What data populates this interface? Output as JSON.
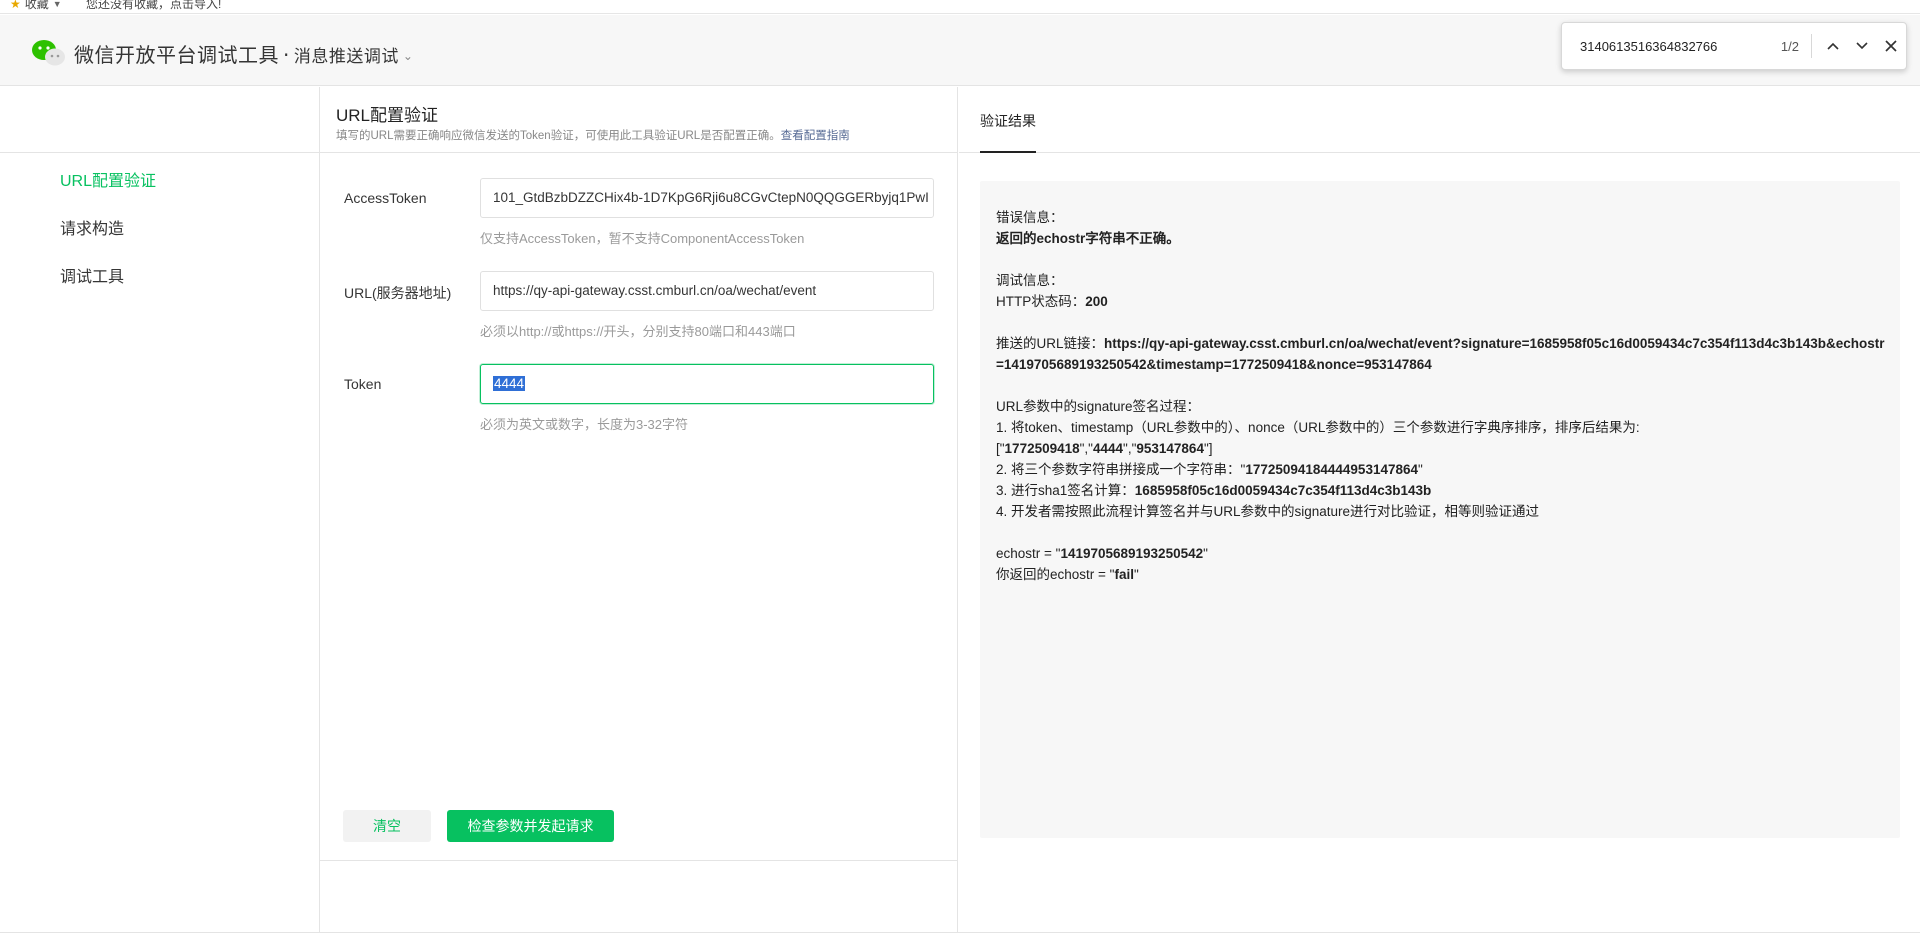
{
  "bookmarks": {
    "favorites_label": "收藏",
    "hint": "您还没有收藏，点击导入!"
  },
  "header": {
    "title": "微信开放平台调试工具",
    "separator": "·",
    "subtitle": "消息推送调试"
  },
  "find_bar": {
    "query": "3140613516364832766",
    "count": "1/2"
  },
  "sidebar": {
    "items": [
      {
        "label": "URL配置验证",
        "active": true
      },
      {
        "label": "请求构造",
        "active": false
      },
      {
        "label": "调试工具",
        "active": false
      }
    ]
  },
  "form": {
    "title": "URL配置验证",
    "description": "填写的URL需要正确响应微信发送的Token验证，可使用此工具验证URL是否配置正确。",
    "guide_link": "查看配置指南",
    "fields": {
      "access_token": {
        "label": "AccessToken",
        "value": "101_GtdBzbDZZCHix4b-1D7KpG6Rji6u8CGvCtepN0QQGGERbyjq1PwI",
        "hint": "仅支持AccessToken，暂不支持ComponentAccessToken"
      },
      "url": {
        "label": "URL(服务器地址)",
        "value": "https://qy-api-gateway.csst.cmburl.cn/oa/wechat/event",
        "hint": "必须以http://或https://开头，分别支持80端口和443端口"
      },
      "token": {
        "label": "Token",
        "value": "4444",
        "hint": "必须为英文或数字，长度为3-32字符"
      }
    },
    "clear_label": "清空",
    "submit_label": "检查参数并发起请求"
  },
  "result": {
    "tab_label": "验证结果",
    "error_title": "错误信息：",
    "error_msg": "返回的echostr字符串不正确。",
    "debug_title": "调试信息：",
    "http_status_label": "HTTP状态码：",
    "http_status": "200",
    "push_url_label": "推送的URL链接：",
    "push_url": "https://qy-api-gateway.csst.cmburl.cn/oa/wechat/event?signature=1685958f05c16d0059434c7c354f113d4c3b143b&echostr=1419705689193250542&timestamp=1772509418&nonce=953147864",
    "sig_title": "URL参数中的signature签名过程：",
    "step1": "1. 将token、timestamp（URL参数中的）、nonce（URL参数中的）三个参数进行字典序排序，排序后结果为:",
    "step1_open": "[\"",
    "step1_v1": "1772509418",
    "step1_mid1": "\",\"",
    "step1_v2": "4444",
    "step1_mid2": "\",\"",
    "step1_v3": "953147864",
    "step1_close": "\"]",
    "step2_label": "2. 将三个参数字符串拼接成一个字符串：\"",
    "step2_value": "17725094184444953147864",
    "step2_close": "\"",
    "step3_label": "3. 进行sha1签名计算：",
    "step3_value": "1685958f05c16d0059434c7c354f113d4c3b143b",
    "step4": "4. 开发者需按照此流程计算签名并与URL参数中的signature进行对比验证，相等则验证通过",
    "echostr_label": "echostr = \"",
    "echostr_value": "1419705689193250542",
    "echostr_close": "\"",
    "returned_label": "你返回的echostr = \"",
    "returned_value": "fail",
    "returned_close": "\""
  }
}
